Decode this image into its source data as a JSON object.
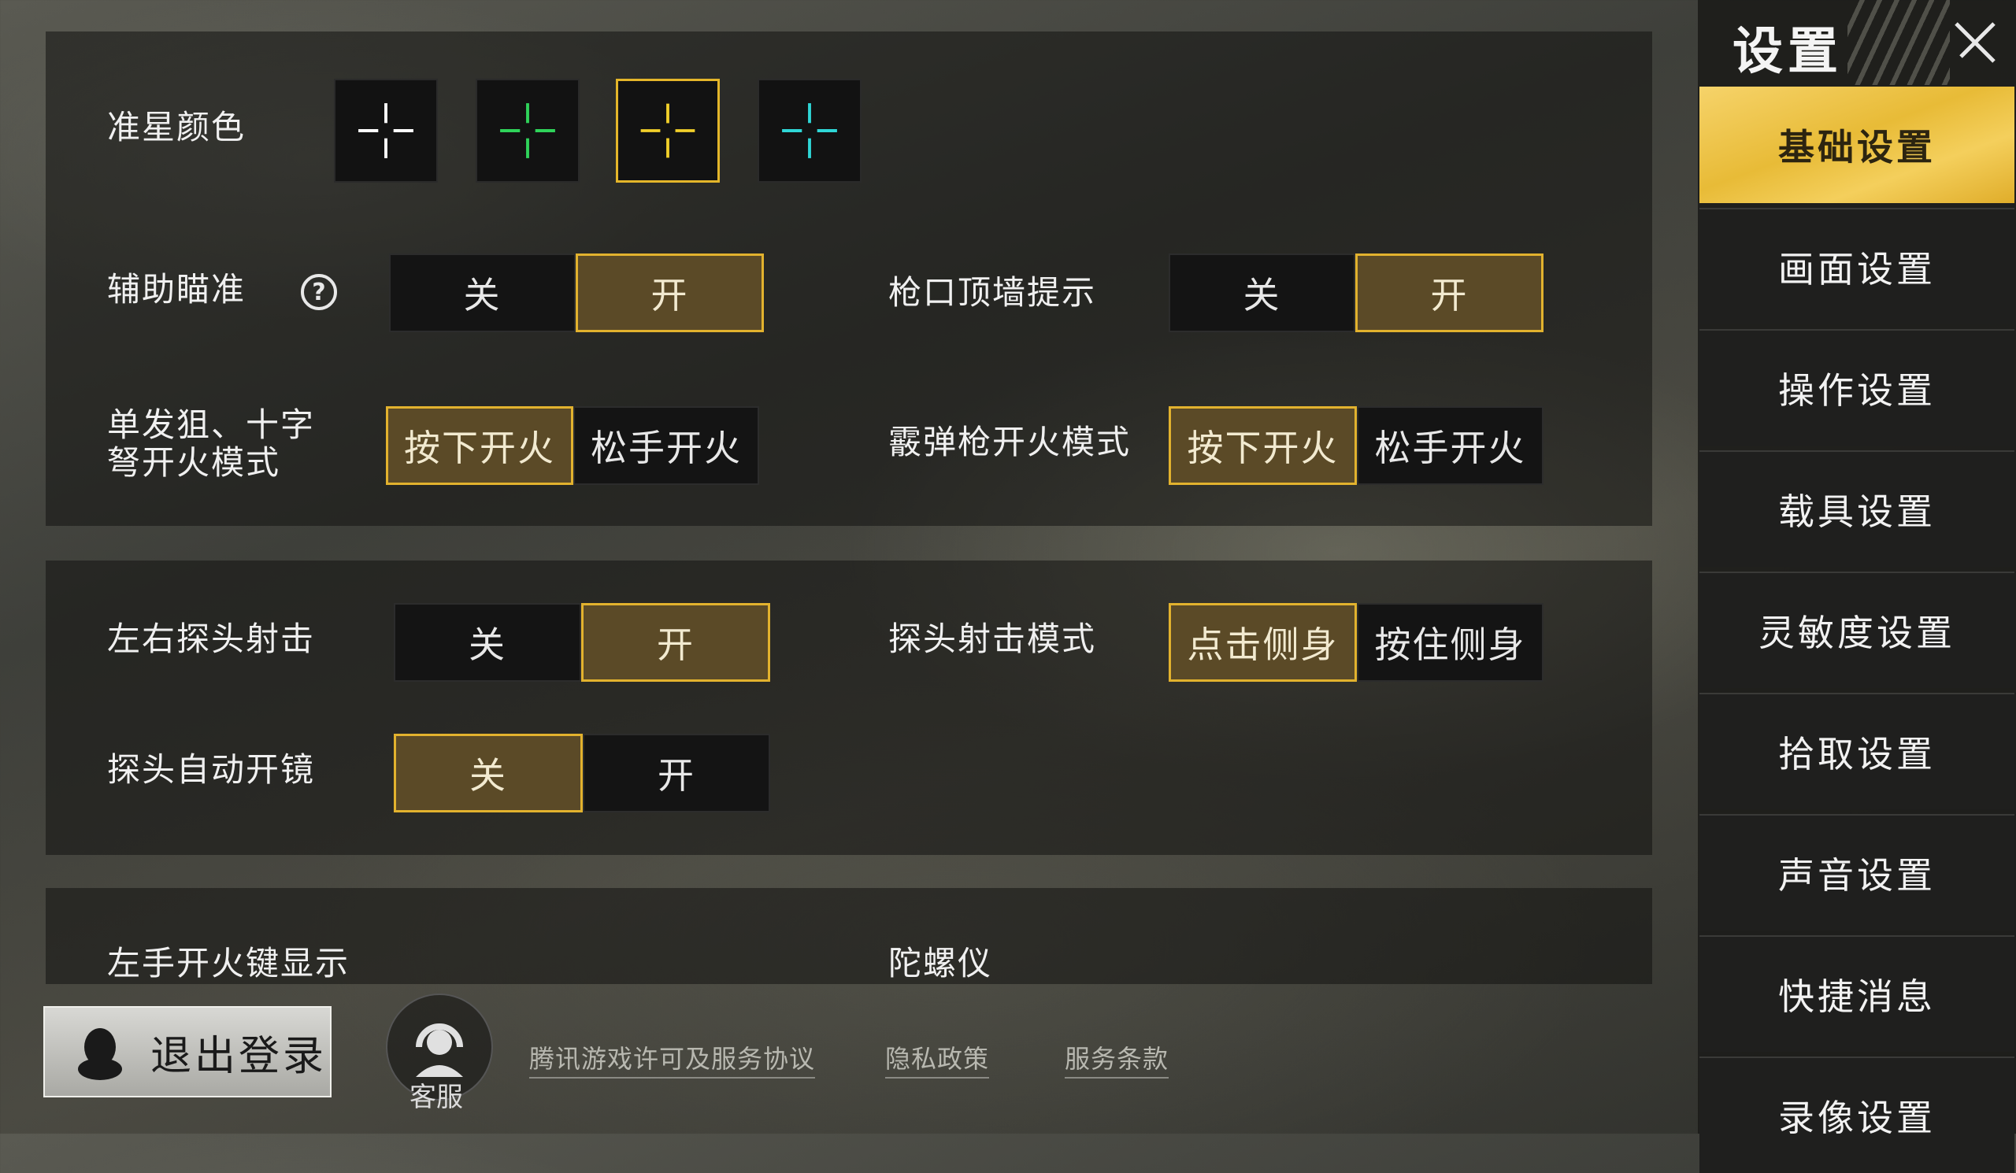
{
  "colors": {
    "accent": "#e2b22e",
    "active_menu": "#f0c94a",
    "white": "#ffffff",
    "green": "#2fd35a",
    "yellow": "#f2d02a",
    "cyan": "#2fd6d6"
  },
  "crosshair": {
    "label": "准星颜色",
    "options": [
      {
        "name": "white",
        "color": "#ffffff",
        "selected": false
      },
      {
        "name": "green",
        "color": "#2fd35a",
        "selected": false
      },
      {
        "name": "yellow",
        "color": "#f2d02a",
        "selected": true
      },
      {
        "name": "cyan",
        "color": "#2fd6d6",
        "selected": false
      }
    ]
  },
  "aim_assist": {
    "label": "辅助瞄准",
    "help": "?",
    "off": "关",
    "on": "开",
    "value": "开"
  },
  "muzzle_wall_hint": {
    "label": "枪口顶墙提示",
    "off": "关",
    "on": "开",
    "value": "开"
  },
  "sniper_fire_mode": {
    "label": "单发狙、十字弩开火模式",
    "opt1": "按下开火",
    "opt2": "松手开火",
    "value": "按下开火"
  },
  "shotgun_fire_mode": {
    "label": "霰弹枪开火模式",
    "opt1": "按下开火",
    "opt2": "松手开火",
    "value": "按下开火"
  },
  "peek_fire": {
    "label": "左右探头射击",
    "off": "关",
    "on": "开",
    "value": "开"
  },
  "peek_mode": {
    "label": "探头射击模式",
    "opt1": "点击侧身",
    "opt2": "按住侧身",
    "value": "点击侧身"
  },
  "peek_auto_scope": {
    "label": "探头自动开镜",
    "off": "关",
    "on": "开",
    "value": "关"
  },
  "left_fire_button": {
    "label": "左手开火键显示"
  },
  "gyroscope": {
    "label": "陀螺仪"
  },
  "sidebar": {
    "title": "设置",
    "items": [
      {
        "label": "基础设置",
        "active": true
      },
      {
        "label": "画面设置",
        "active": false
      },
      {
        "label": "操作设置",
        "active": false
      },
      {
        "label": "载具设置",
        "active": false
      },
      {
        "label": "灵敏度设置",
        "active": false
      },
      {
        "label": "拾取设置",
        "active": false
      },
      {
        "label": "声音设置",
        "active": false
      },
      {
        "label": "快捷消息",
        "active": false
      },
      {
        "label": "录像设置",
        "active": false
      }
    ]
  },
  "footer": {
    "logout": "退出登录",
    "customer_service": "客服",
    "links": [
      "腾讯游戏许可及服务协议",
      "隐私政策",
      "服务条款"
    ]
  }
}
